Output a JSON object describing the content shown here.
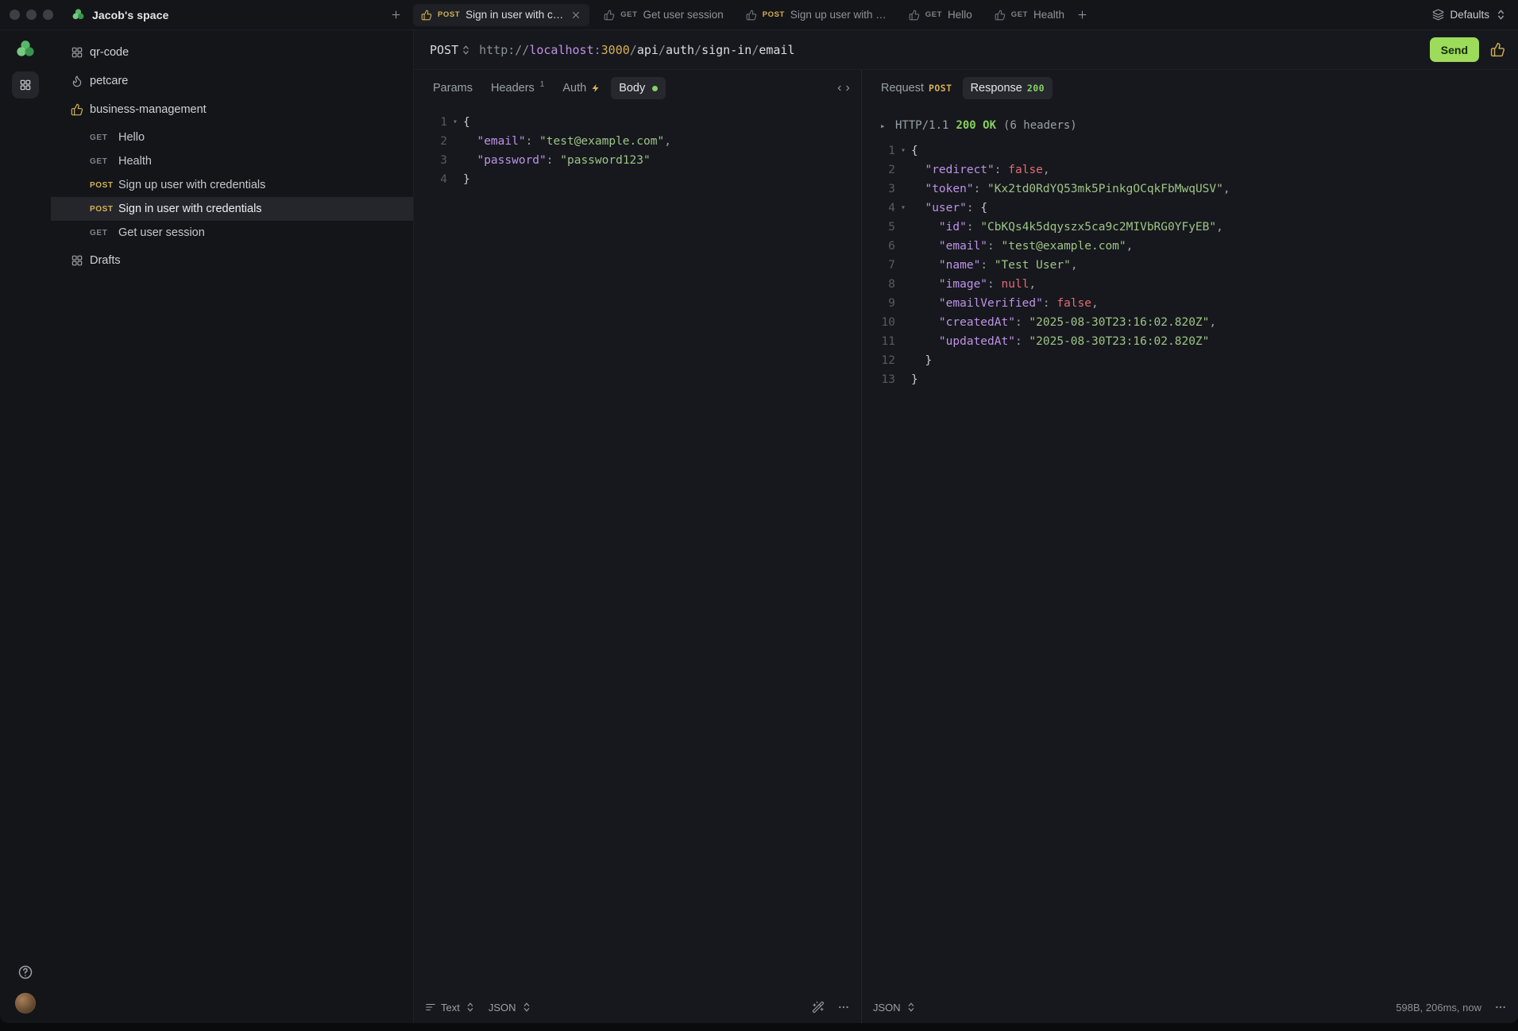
{
  "colors": {
    "accent_send_green": "#9cdc5a",
    "status_green": "#86d05f",
    "method_post_yellow": "#d3b157",
    "json_key_purple": "#bd93e8",
    "json_string_green": "#9dc487",
    "json_keyword_red": "#e06c75"
  },
  "titlebar": {
    "workspace_name": "Jacob's space",
    "workspace_icon": "yaak-logo",
    "new_button_icon": "plus",
    "environment_label": "Defaults",
    "environment_icon": "layers",
    "tabs": [
      {
        "icon": "thumbs-up",
        "method": "POST",
        "label": "Sign in user with c…",
        "active": true,
        "closable": true
      },
      {
        "icon": "thumbs-up",
        "method": "GET",
        "label": "Get user session",
        "active": false,
        "closable": false
      },
      {
        "icon": "thumbs-up",
        "method": "POST",
        "label": "Sign up user with …",
        "active": false,
        "closable": false
      },
      {
        "icon": "thumbs-up",
        "method": "GET",
        "label": "Hello",
        "active": false,
        "closable": false
      },
      {
        "icon": "thumbs-up",
        "method": "GET",
        "label": "Health",
        "active": false,
        "closable": false
      }
    ]
  },
  "rail": {
    "top_icons": [
      "yaak-logo",
      "apps-grid"
    ],
    "bottom_icons": [
      "help-circle",
      "user-avatar"
    ]
  },
  "sidebar": {
    "items": [
      {
        "kind": "folder",
        "icon": "grid",
        "label": "qr-code",
        "children": []
      },
      {
        "kind": "folder",
        "icon": "flame",
        "label": "petcare",
        "children": []
      },
      {
        "kind": "folder",
        "icon": "thumbs-up",
        "icon_color": "#d3b157",
        "label": "business-management",
        "children": [
          {
            "method": "GET",
            "label": "Hello",
            "selected": false
          },
          {
            "method": "GET",
            "label": "Health",
            "selected": false
          },
          {
            "method": "POST",
            "label": "Sign up user with credentials",
            "selected": false
          },
          {
            "method": "POST",
            "label": "Sign in user with credentials",
            "selected": true
          },
          {
            "method": "GET",
            "label": "Get user session",
            "selected": false
          }
        ]
      },
      {
        "kind": "folder",
        "icon": "grid",
        "label": "Drafts",
        "children": []
      }
    ]
  },
  "urlbar": {
    "method": "POST",
    "url": "http://localhost:3000/api/auth/sign-in/email",
    "url_tokens": [
      {
        "t": "http",
        "c": "muted"
      },
      {
        "t": "://",
        "c": "muted"
      },
      {
        "t": "localhost",
        "c": "host"
      },
      {
        "t": ":",
        "c": "muted"
      },
      {
        "t": "3000",
        "c": "port"
      },
      {
        "t": "/",
        "c": "muted"
      },
      {
        "t": "api",
        "c": "path"
      },
      {
        "t": "/",
        "c": "muted"
      },
      {
        "t": "auth",
        "c": "path"
      },
      {
        "t": "/",
        "c": "muted"
      },
      {
        "t": "sign-in",
        "c": "path"
      },
      {
        "t": "/",
        "c": "muted"
      },
      {
        "t": "email",
        "c": "path"
      }
    ],
    "send_label": "Send",
    "favorite_icon": "thumbs-up"
  },
  "request": {
    "tabs": {
      "params": "Params",
      "headers": "Headers",
      "headers_badge": "1",
      "auth": "Auth",
      "auth_icon": "zap",
      "body": "Body",
      "body_indicator": "green-dot",
      "right_icon": "code-brackets"
    },
    "body_lines": [
      {
        "n": "1",
        "fold": true,
        "tokens": [
          {
            "t": "{",
            "c": "brace"
          }
        ]
      },
      {
        "n": "2",
        "fold": false,
        "tokens": [
          {
            "t": "  ",
            "c": "plain"
          },
          {
            "t": "\"email\"",
            "c": "key"
          },
          {
            "t": ":",
            "c": "punct"
          },
          {
            "t": " ",
            "c": "plain"
          },
          {
            "t": "\"test@example.com\"",
            "c": "str"
          },
          {
            "t": ",",
            "c": "punct"
          }
        ]
      },
      {
        "n": "3",
        "fold": false,
        "tokens": [
          {
            "t": "  ",
            "c": "plain"
          },
          {
            "t": "\"password\"",
            "c": "key"
          },
          {
            "t": ":",
            "c": "punct"
          },
          {
            "t": " ",
            "c": "plain"
          },
          {
            "t": "\"password123\"",
            "c": "str"
          }
        ]
      },
      {
        "n": "4",
        "fold": false,
        "tokens": [
          {
            "t": "}",
            "c": "brace"
          }
        ]
      }
    ],
    "footer": {
      "wrap_label": "Text",
      "wrap_icon": "text-lines",
      "language_label": "JSON",
      "format_icon": "wand",
      "more_icon": "ellipsis"
    }
  },
  "response": {
    "tabs": {
      "request_label": "Request",
      "request_method": "POST",
      "response_label": "Response",
      "status_code": "200"
    },
    "status_line": {
      "protocol": "HTTP/1.1",
      "status": "200 OK",
      "headers_summary": "(6 headers)"
    },
    "body_lines": [
      {
        "n": "1",
        "fold": true,
        "tokens": [
          {
            "t": "{",
            "c": "brace"
          }
        ]
      },
      {
        "n": "2",
        "fold": false,
        "tokens": [
          {
            "t": "  ",
            "c": "plain"
          },
          {
            "t": "\"redirect\"",
            "c": "key"
          },
          {
            "t": ":",
            "c": "punct"
          },
          {
            "t": " ",
            "c": "plain"
          },
          {
            "t": "false",
            "c": "kw"
          },
          {
            "t": ",",
            "c": "punct"
          }
        ]
      },
      {
        "n": "3",
        "fold": false,
        "tokens": [
          {
            "t": "  ",
            "c": "plain"
          },
          {
            "t": "\"token\"",
            "c": "key"
          },
          {
            "t": ":",
            "c": "punct"
          },
          {
            "t": " ",
            "c": "plain"
          },
          {
            "t": "\"Kx2td0RdYQ53mk5PinkgOCqkFbMwqUSV\"",
            "c": "str"
          },
          {
            "t": ",",
            "c": "punct"
          }
        ]
      },
      {
        "n": "4",
        "fold": true,
        "tokens": [
          {
            "t": "  ",
            "c": "plain"
          },
          {
            "t": "\"user\"",
            "c": "key"
          },
          {
            "t": ":",
            "c": "punct"
          },
          {
            "t": " ",
            "c": "plain"
          },
          {
            "t": "{",
            "c": "brace"
          }
        ]
      },
      {
        "n": "5",
        "fold": false,
        "tokens": [
          {
            "t": "    ",
            "c": "plain"
          },
          {
            "t": "\"id\"",
            "c": "key"
          },
          {
            "t": ":",
            "c": "punct"
          },
          {
            "t": " ",
            "c": "plain"
          },
          {
            "t": "\"CbKQs4k5dqyszx5ca9c2MIVbRG0YFyEB\"",
            "c": "str"
          },
          {
            "t": ",",
            "c": "punct"
          }
        ]
      },
      {
        "n": "6",
        "fold": false,
        "tokens": [
          {
            "t": "    ",
            "c": "plain"
          },
          {
            "t": "\"email\"",
            "c": "key"
          },
          {
            "t": ":",
            "c": "punct"
          },
          {
            "t": " ",
            "c": "plain"
          },
          {
            "t": "\"test@example.com\"",
            "c": "str"
          },
          {
            "t": ",",
            "c": "punct"
          }
        ]
      },
      {
        "n": "7",
        "fold": false,
        "tokens": [
          {
            "t": "    ",
            "c": "plain"
          },
          {
            "t": "\"name\"",
            "c": "key"
          },
          {
            "t": ":",
            "c": "punct"
          },
          {
            "t": " ",
            "c": "plain"
          },
          {
            "t": "\"Test User\"",
            "c": "str"
          },
          {
            "t": ",",
            "c": "punct"
          }
        ]
      },
      {
        "n": "8",
        "fold": false,
        "tokens": [
          {
            "t": "    ",
            "c": "plain"
          },
          {
            "t": "\"image\"",
            "c": "key"
          },
          {
            "t": ":",
            "c": "punct"
          },
          {
            "t": " ",
            "c": "plain"
          },
          {
            "t": "null",
            "c": "kw"
          },
          {
            "t": ",",
            "c": "punct"
          }
        ]
      },
      {
        "n": "9",
        "fold": false,
        "tokens": [
          {
            "t": "    ",
            "c": "plain"
          },
          {
            "t": "\"emailVerified\"",
            "c": "key"
          },
          {
            "t": ":",
            "c": "punct"
          },
          {
            "t": " ",
            "c": "plain"
          },
          {
            "t": "false",
            "c": "kw"
          },
          {
            "t": ",",
            "c": "punct"
          }
        ]
      },
      {
        "n": "10",
        "fold": false,
        "tokens": [
          {
            "t": "    ",
            "c": "plain"
          },
          {
            "t": "\"createdAt\"",
            "c": "key"
          },
          {
            "t": ":",
            "c": "punct"
          },
          {
            "t": " ",
            "c": "plain"
          },
          {
            "t": "\"2025-08-30T23:16:02.820Z\"",
            "c": "str"
          },
          {
            "t": ",",
            "c": "punct"
          }
        ]
      },
      {
        "n": "11",
        "fold": false,
        "tokens": [
          {
            "t": "    ",
            "c": "plain"
          },
          {
            "t": "\"updatedAt\"",
            "c": "key"
          },
          {
            "t": ":",
            "c": "punct"
          },
          {
            "t": " ",
            "c": "plain"
          },
          {
            "t": "\"2025-08-30T23:16:02.820Z\"",
            "c": "str"
          }
        ]
      },
      {
        "n": "12",
        "fold": false,
        "tokens": [
          {
            "t": "  ",
            "c": "plain"
          },
          {
            "t": "}",
            "c": "brace"
          }
        ]
      },
      {
        "n": "13",
        "fold": false,
        "tokens": [
          {
            "t": "}",
            "c": "brace"
          }
        ]
      }
    ],
    "footer": {
      "language_label": "JSON",
      "meta": "598B, 206ms, now",
      "more_icon": "ellipsis"
    }
  }
}
